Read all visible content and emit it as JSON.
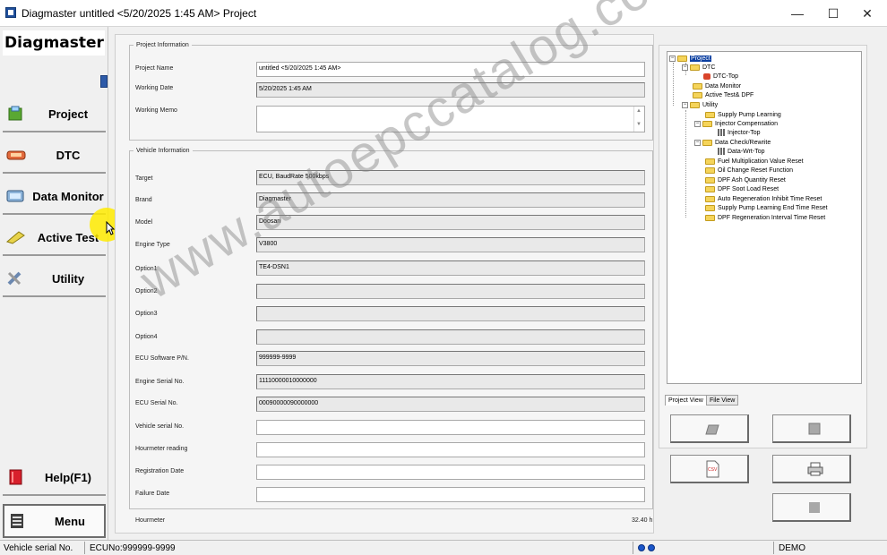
{
  "window": {
    "title": "Diagmaster untitled <5/20/2025 1:45 AM> Project",
    "minimize_glyph": "—",
    "maximize_glyph": "☐",
    "close_glyph": "✕"
  },
  "sidebar": {
    "logo": "Diagmaster",
    "items": [
      {
        "label": "Project",
        "icon": "project-icon"
      },
      {
        "label": "DTC",
        "icon": "dtc-icon"
      },
      {
        "label": "Data Monitor",
        "icon": "data-monitor-icon"
      },
      {
        "label": "Active Test",
        "icon": "active-test-icon"
      },
      {
        "label": "Utility",
        "icon": "utility-icon"
      },
      {
        "label": "Help(F1)",
        "icon": "help-book-icon"
      }
    ],
    "menu_label": "Menu"
  },
  "project_info": {
    "legend": "Project Information",
    "project_name_label": "Project Name",
    "project_name_value": "untitled <5/20/2025 1:45 AM>",
    "working_date_label": "Working Date",
    "working_date_value": "5/20/2025 1:45 AM",
    "working_memo_label": "Working Memo",
    "working_memo_value": ""
  },
  "vehicle_info": {
    "legend": "Vehicle Information",
    "fields": [
      {
        "label": "Target",
        "value": "ECU, BaudRate 500kbps",
        "editable": false
      },
      {
        "label": "Brand",
        "value": "Diagmaster",
        "editable": false
      },
      {
        "label": "Model",
        "value": "Doosan",
        "editable": false
      },
      {
        "label": "Engine Type",
        "value": "V3800",
        "editable": false
      },
      {
        "label": "Option1",
        "value": "TE4-DSN1",
        "editable": false
      },
      {
        "label": "Option2",
        "value": "",
        "editable": false
      },
      {
        "label": "Option3",
        "value": "",
        "editable": false
      },
      {
        "label": "Option4",
        "value": "",
        "editable": false
      },
      {
        "label": "ECU Software P/N.",
        "value": "999999-9999",
        "editable": false
      },
      {
        "label": "Engine Serial No.",
        "value": "11110000010000000",
        "editable": false
      },
      {
        "label": "ECU Serial No.",
        "value": "00090000090000000",
        "editable": false
      },
      {
        "label": "Vehicle serial No.",
        "value": "",
        "editable": true
      },
      {
        "label": "Hourmeter reading",
        "value": "",
        "editable": true
      },
      {
        "label": "Registration Date",
        "value": "",
        "editable": true
      },
      {
        "label": "Failure Date",
        "value": "",
        "editable": true
      }
    ],
    "hourmeter_label": "Hourmeter",
    "hourmeter_value": "32.40 h"
  },
  "tree": {
    "nodes": [
      {
        "label": "Project",
        "icon": "folder-icon",
        "level": 0,
        "expander": "−",
        "selected": true
      },
      {
        "label": "DTC",
        "icon": "folder-icon",
        "level": 1,
        "expander": "−"
      },
      {
        "label": "DTC-Top",
        "icon": "dtc-item-icon",
        "level": 2,
        "expander": ""
      },
      {
        "label": "Data Monitor",
        "icon": "folder-icon",
        "level": 1,
        "expander": ""
      },
      {
        "label": "Active Test& DPF",
        "icon": "folder-icon",
        "level": 1,
        "expander": ""
      },
      {
        "label": "Utility",
        "icon": "folder-icon",
        "level": 1,
        "expander": "−"
      },
      {
        "label": "Supply Pump Learning",
        "icon": "folder-icon",
        "level": 2,
        "expander": ""
      },
      {
        "label": "Injector Compensation",
        "icon": "folder-icon",
        "level": 2,
        "expander": "−"
      },
      {
        "label": "Injector-Top",
        "icon": "gauge-item-icon",
        "level": 3,
        "expander": ""
      },
      {
        "label": "Data Check/Rewrite",
        "icon": "folder-icon",
        "level": 2,
        "expander": "−"
      },
      {
        "label": "Data-Wrt-Top",
        "icon": "gauge-item-icon",
        "level": 3,
        "expander": ""
      },
      {
        "label": "Fuel Multiplication Value Reset",
        "icon": "folder-icon",
        "level": 2,
        "expander": ""
      },
      {
        "label": "Oil Change Reset Function",
        "icon": "folder-icon",
        "level": 2,
        "expander": ""
      },
      {
        "label": "DPF Ash Quantity Reset",
        "icon": "folder-icon",
        "level": 2,
        "expander": ""
      },
      {
        "label": "DPF Soot Load Reset",
        "icon": "folder-icon",
        "level": 2,
        "expander": ""
      },
      {
        "label": "Auto Regeneration Inhibit Time Reset",
        "icon": "folder-icon",
        "level": 2,
        "expander": ""
      },
      {
        "label": "Supply Pump Learning End Time Reset",
        "icon": "folder-icon",
        "level": 2,
        "expander": ""
      },
      {
        "label": "DPF Regeneration Interval Time Reset",
        "icon": "folder-icon",
        "level": 2,
        "expander": ""
      }
    ],
    "tab_project_view": "Project View",
    "tab_file_view": "File View"
  },
  "right_buttons": [
    {
      "name": "open-project-button",
      "icon": "open-folder-icon"
    },
    {
      "name": "save-project-button",
      "icon": "save-chip-icon"
    },
    {
      "name": "export-csv-button",
      "icon": "csv-file-icon",
      "icon_text": "CSV"
    },
    {
      "name": "print-button",
      "icon": "printer-icon"
    },
    {
      "name": "blank-button",
      "icon": "blank-icon"
    }
  ],
  "statusbar": {
    "vehicle_serial": "Vehicle serial No.",
    "ecu_no": "ECUNo:999999-9999",
    "mode": "DEMO"
  },
  "watermark": "www.autoepccatalog.com",
  "colors": {
    "selection": "#0a3ea0",
    "folder": "#f5d45a",
    "cursor_highlight": "#ffeb00",
    "status_led": "#1a56c9"
  }
}
